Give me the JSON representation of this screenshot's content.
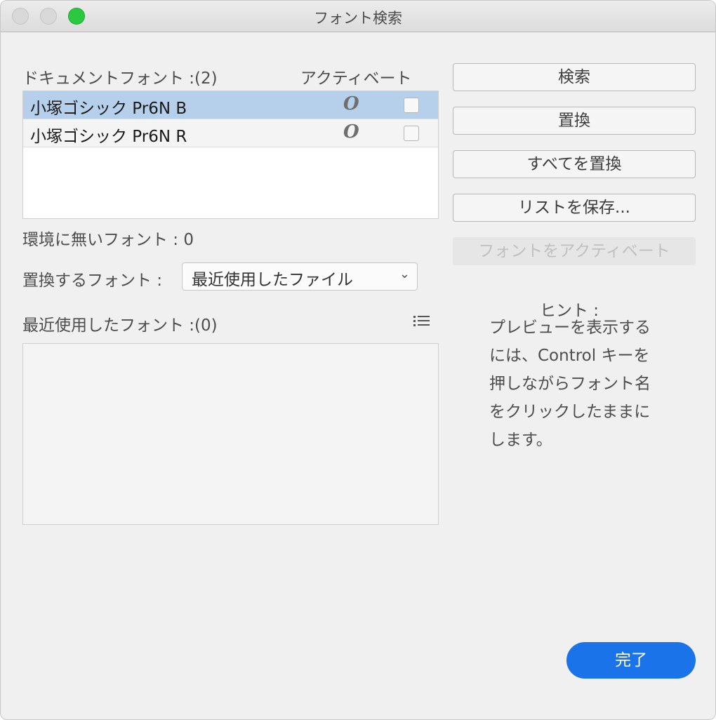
{
  "window": {
    "title": "フォント検索"
  },
  "document_fonts": {
    "header": "ドキュメントフォント :(2)",
    "active_header": "アクティベート",
    "rows": [
      {
        "name": "小塚ゴシック Pr6N B",
        "type_icon": "O",
        "selected": true,
        "checked": false
      },
      {
        "name": "小塚ゴシック Pr6N R",
        "type_icon": "O",
        "selected": false,
        "checked": false
      }
    ]
  },
  "missing_fonts": {
    "label": "環境に無いフォント : 0"
  },
  "replace_font": {
    "label": "置換するフォント :",
    "selected": "最近使用したファイル"
  },
  "recent_fonts": {
    "header": "最近使用したフォント :(0)"
  },
  "buttons": {
    "find": "検索",
    "replace": "置換",
    "replace_all": "すべてを置換",
    "save_list": "リストを保存...",
    "activate": "フォントをアクティベート",
    "done": "完了"
  },
  "hint": {
    "title": "ヒント :",
    "text": "プレビューを表示するには、Control キーを押しながらフォント名をクリックしたままにします。"
  },
  "icons": {
    "close": "close-icon",
    "minimize": "minimize-icon",
    "zoom": "zoom-icon",
    "font_type": "opentype-font-icon",
    "list_view": "list-view-icon",
    "dropdown": "chevron-down-icon"
  }
}
